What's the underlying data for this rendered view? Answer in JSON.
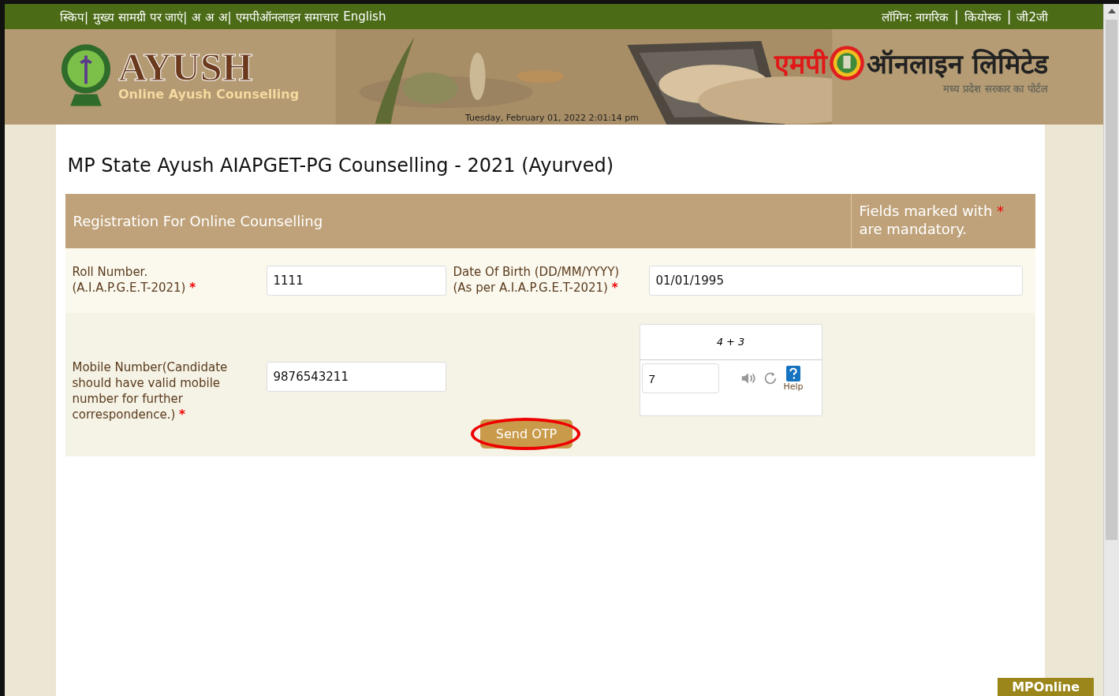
{
  "top_bar": {
    "left_links": [
      {
        "text": "स्किप|",
        "kind": "link"
      },
      {
        "text": "मुख्य सामग्री पर जाएं|",
        "kind": "link"
      },
      {
        "text": "अ",
        "kind": "link"
      },
      {
        "text": "अ",
        "kind": "link"
      },
      {
        "text": "अ|",
        "kind": "link"
      },
      {
        "text": "एमपीऑनलाइन समाचार",
        "kind": "link"
      },
      {
        "text": "English",
        "kind": "link"
      }
    ],
    "right_links": [
      {
        "text": "लॉगिन:",
        "kind": "label"
      },
      {
        "text": "नागरिक",
        "kind": "link"
      },
      {
        "text": "|",
        "kind": "sep"
      },
      {
        "text": "कियोस्क",
        "kind": "link"
      },
      {
        "text": "|",
        "kind": "sep"
      },
      {
        "text": "जी2जी",
        "kind": "link"
      }
    ]
  },
  "header": {
    "logo_title": "AYUSH",
    "logo_subtitle": "Online Ayush Counselling",
    "datetime": "Tuesday, February 01, 2022 2:01:14 pm",
    "partner_red": "एमपी",
    "partner_name": "ऑनलाइन लिमिटेड",
    "partner_tagline": "मध्य प्रदेश सरकार का पोर्टल"
  },
  "page_title": "MP State Ayush AIAPGET-PG Counselling - 2021 (Ayurved)",
  "form": {
    "heading": "Registration For Online Counselling",
    "note_before": "Fields marked with",
    "note_mark": "*",
    "note_after": "are mandatory.",
    "fields": [
      {
        "label": [
          "Roll Number.",
          "(A.I.A.P.G.E.T-2021)"
        ],
        "required": true,
        "value": "1111"
      },
      {
        "label": [
          "Date Of Birth (DD/MM/YYYY)",
          "(As per A.I.A.P.G.E.T-2021)"
        ],
        "required": true,
        "value": "01/01/1995"
      },
      {
        "label": [
          "Mobile Number(Candidate should have valid mobile number for further correspondence.)"
        ],
        "required": true,
        "value": "9876543211"
      }
    ],
    "captcha": {
      "question": "4 + 3",
      "answer": "7",
      "help": "Help"
    },
    "button": {
      "label": "Send OTP",
      "highlighted": true
    }
  },
  "footer_tab": "MPOnline"
}
